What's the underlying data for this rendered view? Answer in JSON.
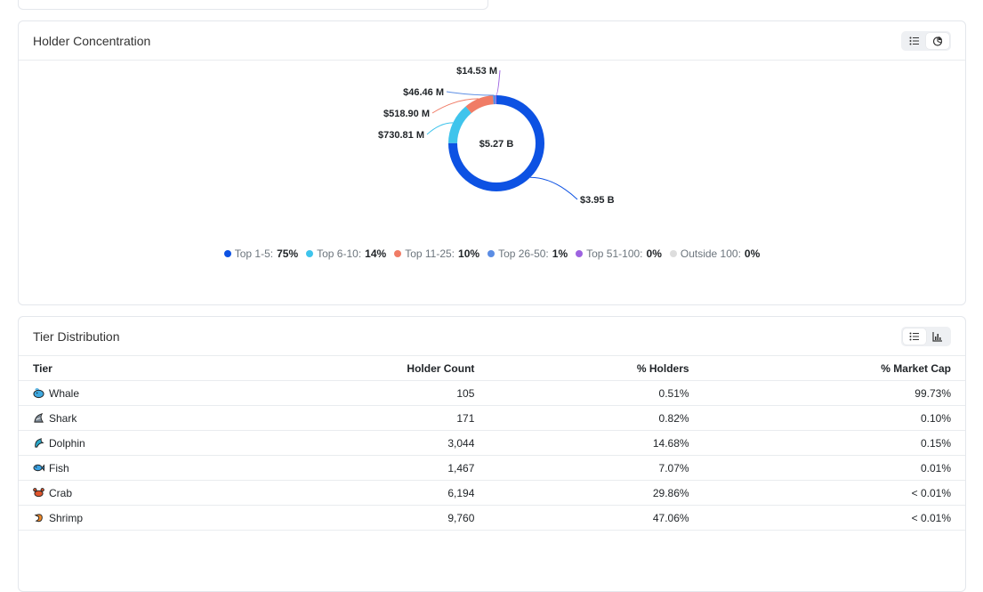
{
  "holder_concentration": {
    "title": "Holder Concentration",
    "center_label": "$5.27 B",
    "slice_labels": [
      "$3.95 B",
      "$730.81 M",
      "$518.90 M",
      "$46.46 M",
      "$14.53 M"
    ],
    "legend": [
      {
        "name": "Top 1-5:",
        "value": "75%",
        "color": "#0d52e3"
      },
      {
        "name": "Top 6-10:",
        "value": "14%",
        "color": "#3fc4ec"
      },
      {
        "name": "Top 11-25:",
        "value": "10%",
        "color": "#f07c66"
      },
      {
        "name": "Top 26-50:",
        "value": "1%",
        "color": "#5b8de4"
      },
      {
        "name": "Top 51-100:",
        "value": "0%",
        "color": "#9d63e0"
      },
      {
        "name": "Outside 100:",
        "value": "0%",
        "color": "#dddddd"
      }
    ],
    "toggle_icons": [
      "list-icon",
      "pie-chart-icon"
    ]
  },
  "chart_data": {
    "type": "pie",
    "center_label": "$5.27 B",
    "slices": [
      {
        "label": "Top 1-5",
        "value": 3950,
        "display": "$3.95 B",
        "percent": "75%",
        "color": "#0d52e3"
      },
      {
        "label": "Top 6-10",
        "value": 730.81,
        "display": "$730.81 M",
        "percent": "14%",
        "color": "#3fc4ec"
      },
      {
        "label": "Top 11-25",
        "value": 518.9,
        "display": "$518.90 M",
        "percent": "10%",
        "color": "#f07c66"
      },
      {
        "label": "Top 26-50",
        "value": 46.46,
        "display": "$46.46 M",
        "percent": "1%",
        "color": "#5b8de4"
      },
      {
        "label": "Top 51-100",
        "value": 14.53,
        "display": "$14.53 M",
        "percent": "0%",
        "color": "#9d63e0"
      },
      {
        "label": "Outside 100",
        "value": 0,
        "display": "",
        "percent": "0%",
        "color": "#dddddd"
      }
    ],
    "legend_position": "bottom"
  },
  "tier_distribution": {
    "title": "Tier Distribution",
    "toggle_icons": [
      "list-icon",
      "bar-chart-icon"
    ],
    "columns": [
      "Tier",
      "Holder Count",
      "% Holders",
      "% Market Cap"
    ],
    "rows": [
      {
        "tier": "Whale",
        "icon": "whale-icon",
        "count": "105",
        "holders": "0.51%",
        "market_cap": "99.73%"
      },
      {
        "tier": "Shark",
        "icon": "shark-icon",
        "count": "171",
        "holders": "0.82%",
        "market_cap": "0.10%"
      },
      {
        "tier": "Dolphin",
        "icon": "dolphin-icon",
        "count": "3,044",
        "holders": "14.68%",
        "market_cap": "0.15%"
      },
      {
        "tier": "Fish",
        "icon": "fish-icon",
        "count": "1,467",
        "holders": "7.07%",
        "market_cap": "0.01%"
      },
      {
        "tier": "Crab",
        "icon": "crab-icon",
        "count": "6,194",
        "holders": "29.86%",
        "market_cap": "< 0.01%"
      },
      {
        "tier": "Shrimp",
        "icon": "shrimp-icon",
        "count": "9,760",
        "holders": "47.06%",
        "market_cap": "< 0.01%"
      }
    ]
  }
}
